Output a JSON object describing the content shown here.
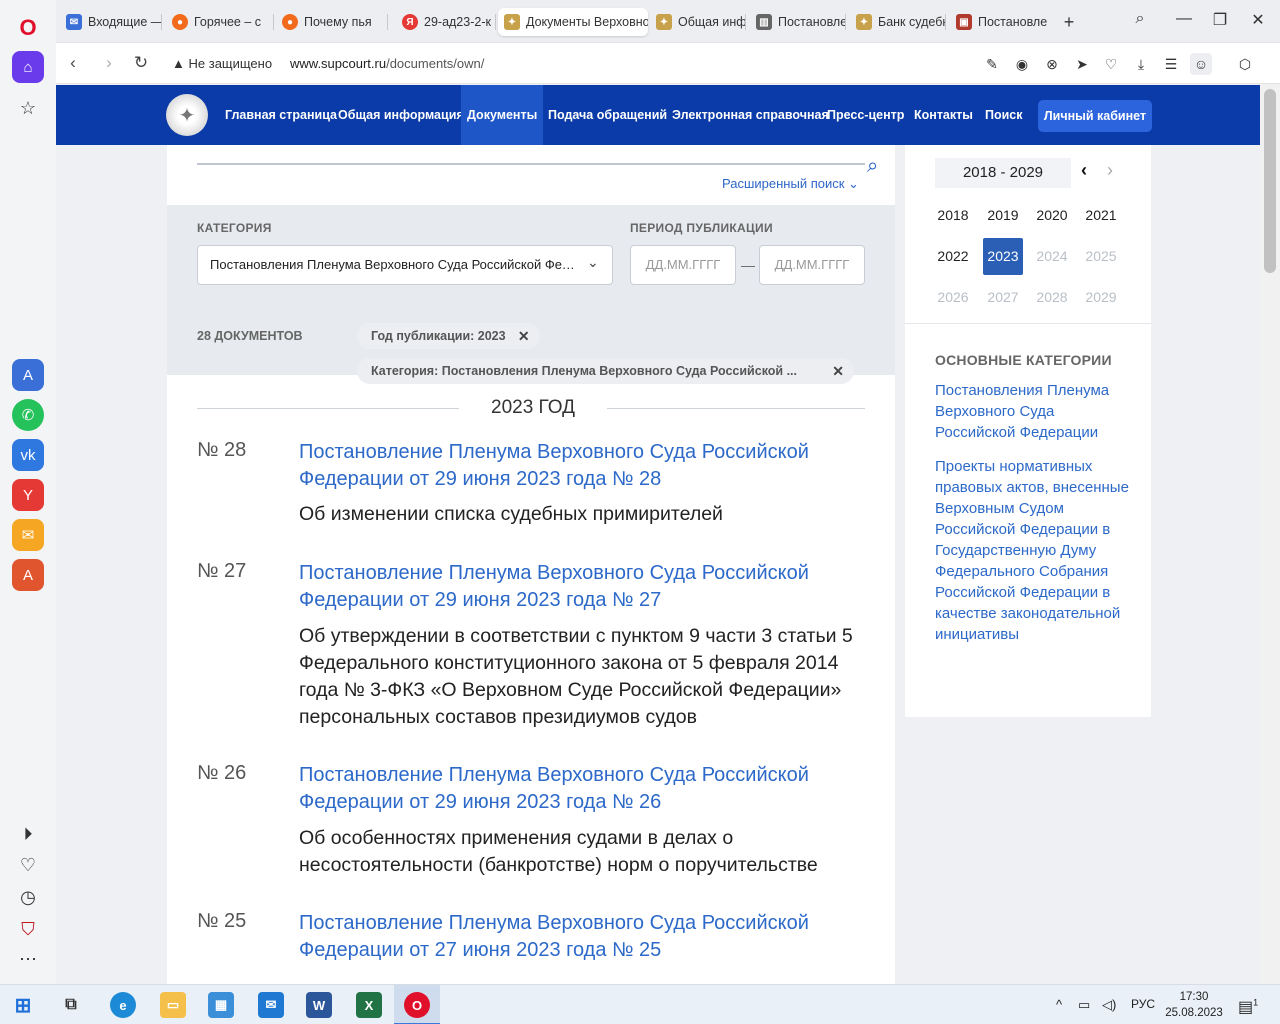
{
  "browser": {
    "tabs": [
      {
        "label": "Входящие — ",
        "color": "#3b6fd8",
        "glyph": "✉"
      },
      {
        "label": "Горячее – с",
        "color": "#f26b1d",
        "glyph": "●"
      },
      {
        "label": "Почему пья",
        "color": "#f26b1d",
        "glyph": "●"
      },
      {
        "label": "29-ад23-2-к",
        "color": "#e53935",
        "glyph": "Я"
      },
      {
        "label": "Документы Верховно",
        "color": "#c8a24a",
        "glyph": "✦"
      },
      {
        "label": "Общая инфо",
        "color": "#c8a24a",
        "glyph": "✦"
      },
      {
        "label": "Постановле",
        "color": "#666666",
        "glyph": "▥"
      },
      {
        "label": "Банк судебн",
        "color": "#c8a24a",
        "glyph": "✦"
      },
      {
        "label": "Постановле",
        "color": "#b03a2e",
        "glyph": "▣"
      }
    ],
    "new_tab": "+",
    "security_label": "Не защищено",
    "url_host": "www.supcourt.ru",
    "url_path": "/documents/own/"
  },
  "site": {
    "nav": [
      "Главная страница",
      "Общая информация",
      "Документы",
      "Подача обращений",
      "Электронная справочная",
      "Пресс-центр",
      "Контакты",
      "Поиск"
    ],
    "cabinet": "Личный кабинет"
  },
  "search": {
    "advanced": "Расширенный поиск ⌄"
  },
  "filters": {
    "category_label": "КАТЕГОРИЯ",
    "category_value": "Постановления Пленума Верховного Суда Российской Федерации",
    "period_label": "ПЕРИОД ПУБЛИКАЦИИ",
    "date_from_placeholder": "ДД.ММ.ГГГГ",
    "date_to_placeholder": "ДД.ММ.ГГГГ",
    "dash": "—"
  },
  "results": {
    "count": "28 ДОКУМЕНТОВ",
    "chip_year": "Год публикации: 2023",
    "chip_category": "Категория: Постановления Пленума Верховного Суда Российской ...",
    "year_heading": "2023 ГОД",
    "documents": [
      {
        "num": "№ 28",
        "title": "Постановление Пленума Верховного Суда Российской Федерации от 29 июня 2023 года № 28",
        "desc": "Об изменении списка судебных примирителей"
      },
      {
        "num": "№ 27",
        "title": "Постановление Пленума Верховного Суда Российской Федерации от 29 июня 2023 года № 27",
        "desc": "Об утверждении в соответствии с пунктом 9 части 3 статьи 5 Федерального конституционного закона от 5 февраля 2014 года № 3-ФКЗ «О Верховном Суде Российской Федерации» персональных составов президиумов судов"
      },
      {
        "num": "№ 26",
        "title": "Постановление Пленума Верховного Суда Российской Федерации от 29 июня 2023 года № 26",
        "desc": "Об особенностях применения судами в делах о несостоятельности (банкротстве) норм о поручительстве"
      },
      {
        "num": "№ 25",
        "title": "Постановление Пленума Верховного Суда Российской Федерации от 27 июня 2023 года № 25",
        "desc": ""
      }
    ]
  },
  "calendar": {
    "range": "2018 - 2029",
    "years": [
      {
        "y": "2018",
        "state": "normal"
      },
      {
        "y": "2019",
        "state": "normal"
      },
      {
        "y": "2020",
        "state": "normal"
      },
      {
        "y": "2021",
        "state": "normal"
      },
      {
        "y": "2022",
        "state": "normal"
      },
      {
        "y": "2023",
        "state": "selected"
      },
      {
        "y": "2024",
        "state": "disabled"
      },
      {
        "y": "2025",
        "state": "disabled"
      },
      {
        "y": "2026",
        "state": "disabled"
      },
      {
        "y": "2027",
        "state": "disabled"
      },
      {
        "y": "2028",
        "state": "disabled"
      },
      {
        "y": "2029",
        "state": "disabled"
      }
    ]
  },
  "categories": {
    "title": "ОСНОВНЫЕ КАТЕГОРИИ",
    "items": [
      "Постановления Пленума Верховного Суда Российской Федерации",
      "Проекты нормативных правовых актов, внесенные Верховным Судом Российской Федерации в Государственную Думу Федерального Собрания Российской Федерации в качестве законодательной инициативы"
    ]
  },
  "taskbar": {
    "lang": "РУС",
    "time": "17:30",
    "date": "25.08.2023",
    "notif": "1"
  },
  "colors": {
    "header_blue": "#0a3ba8",
    "link_blue": "#2c69c9",
    "selected_year": "#2a5fb5"
  }
}
